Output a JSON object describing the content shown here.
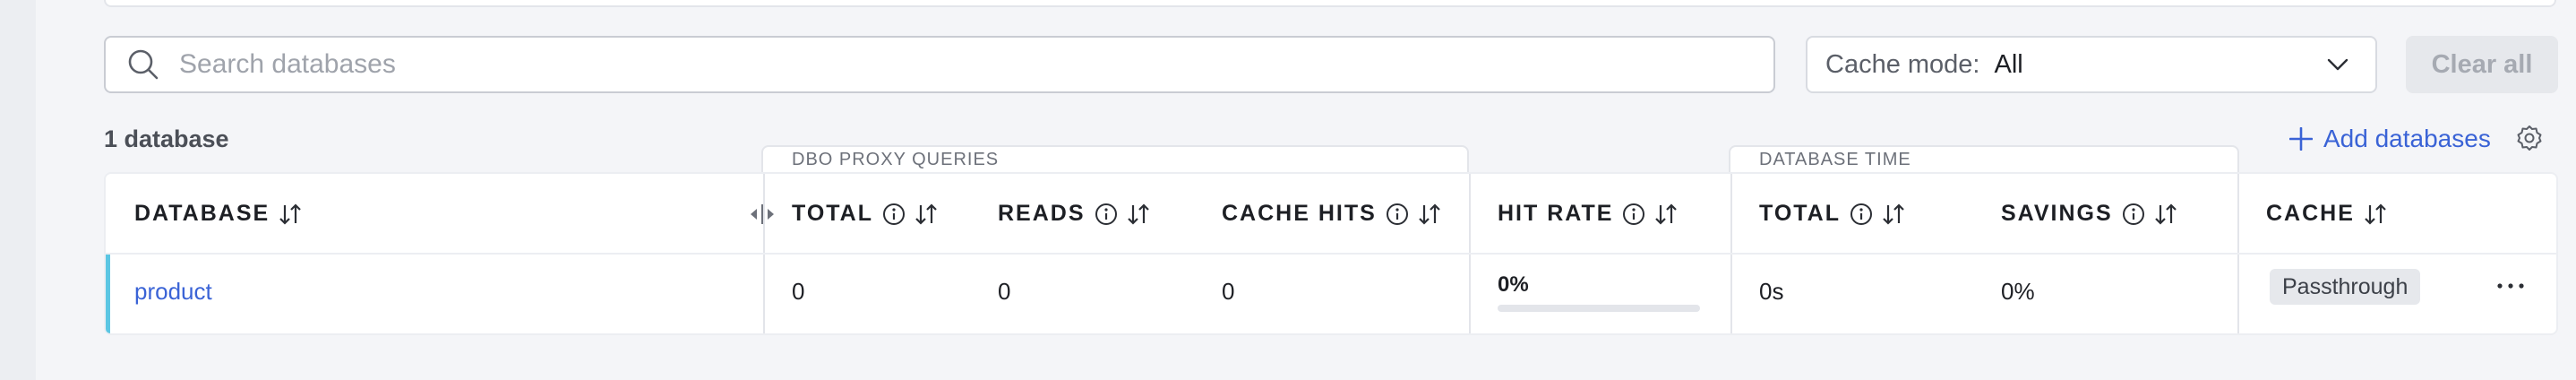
{
  "search": {
    "placeholder": "Search databases",
    "value": ""
  },
  "filters": {
    "cache_mode_label": "Cache mode:",
    "cache_mode_value": "All",
    "clear_label": "Clear all"
  },
  "summary": {
    "count_label": "1 database"
  },
  "actions": {
    "add_databases_label": "Add databases"
  },
  "groups": {
    "proxy_queries": "DBO PROXY QUERIES",
    "database_time": "DATABASE TIME"
  },
  "columns": {
    "database": "DATABASE",
    "total_queries": "TOTAL",
    "reads": "READS",
    "cache_hits": "CACHE HITS",
    "hit_rate": "HIT RATE",
    "total_time": "TOTAL",
    "savings": "SAVINGS",
    "cache": "CACHE"
  },
  "rows": [
    {
      "database": "product",
      "total_queries": "0",
      "reads": "0",
      "cache_hits": "0",
      "hit_rate": "0%",
      "hit_rate_fraction": 0,
      "total_time": "0s",
      "savings": "0%",
      "cache": "Passthrough"
    }
  ],
  "colors": {
    "accent": "#3a63d6",
    "row_marker": "#5bc6e3",
    "background": "#f4f5f8"
  },
  "icons": [
    "search-icon",
    "chevron-down-icon",
    "plus-icon",
    "gear-icon",
    "sort-icon",
    "info-icon",
    "column-resize-icon",
    "more-icon"
  ]
}
